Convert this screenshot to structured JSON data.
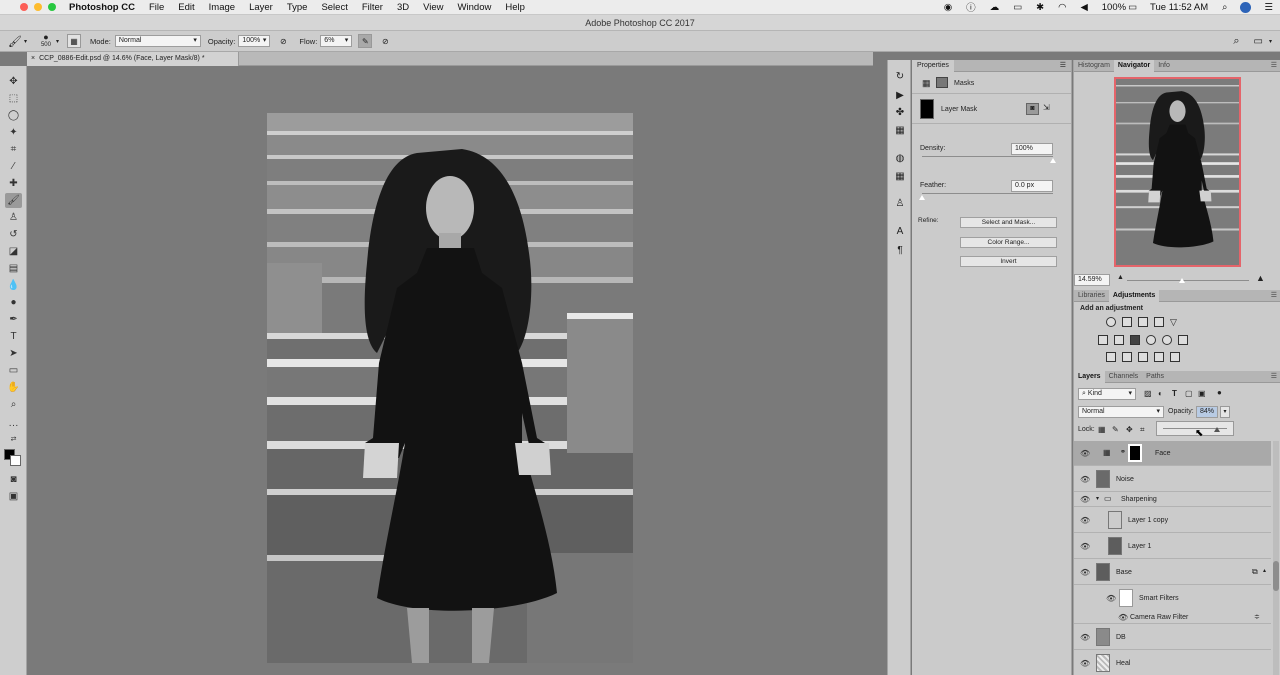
{
  "menubar": {
    "app": "Photoshop CC",
    "items": [
      "File",
      "Edit",
      "Image",
      "Layer",
      "Type",
      "Select",
      "Filter",
      "3D",
      "View",
      "Window",
      "Help"
    ],
    "battery": "100%",
    "clock": "Tue 11:52 AM"
  },
  "window_title": "Adobe Photoshop CC 2017",
  "options": {
    "brush_size": "500",
    "mode_label": "Mode:",
    "mode_value": "Normal",
    "opacity_label": "Opacity:",
    "opacity_value": "100%",
    "flow_label": "Flow:",
    "flow_value": "6%"
  },
  "document_tab": "CCP_0886-Edit.psd @ 14.6% (Face, Layer Mask/8) *",
  "properties": {
    "tab": "Properties",
    "section": "Masks",
    "mask_name": "Layer Mask",
    "density_label": "Density:",
    "density_value": "100%",
    "density_level": 1.0,
    "feather_label": "Feather:",
    "feather_value": "0.0 px",
    "feather_level": 0.0,
    "refine_label": "Refine:",
    "buttons": [
      "Select and Mask...",
      "Color Range...",
      "Invert"
    ]
  },
  "navigator": {
    "tabs": [
      "Histogram",
      "Navigator",
      "Info"
    ],
    "active_tab": "Navigator",
    "zoom": "14.59%",
    "zoom_level": 0.45
  },
  "adjustments": {
    "tabs": [
      "Libraries",
      "Adjustments"
    ],
    "active_tab": "Adjustments",
    "heading": "Add an adjustment"
  },
  "layers_panel": {
    "tabs": [
      "Layers",
      "Channels",
      "Paths"
    ],
    "active_tab": "Layers",
    "filter": "Kind",
    "blend_mode": "Normal",
    "opacity_label": "Opacity:",
    "opacity_value": "84%",
    "opacity_level": 0.84,
    "lock_label": "Lock:",
    "layers": [
      {
        "name": "Face"
      },
      {
        "name": "Noise"
      },
      {
        "name": "Sharpening"
      },
      {
        "name": "Layer 1 copy"
      },
      {
        "name": "Layer 1"
      },
      {
        "name": "Base"
      },
      {
        "name": "Smart Filters"
      },
      {
        "name": "Camera Raw Filter"
      },
      {
        "name": "DB"
      },
      {
        "name": "Heal"
      }
    ]
  }
}
